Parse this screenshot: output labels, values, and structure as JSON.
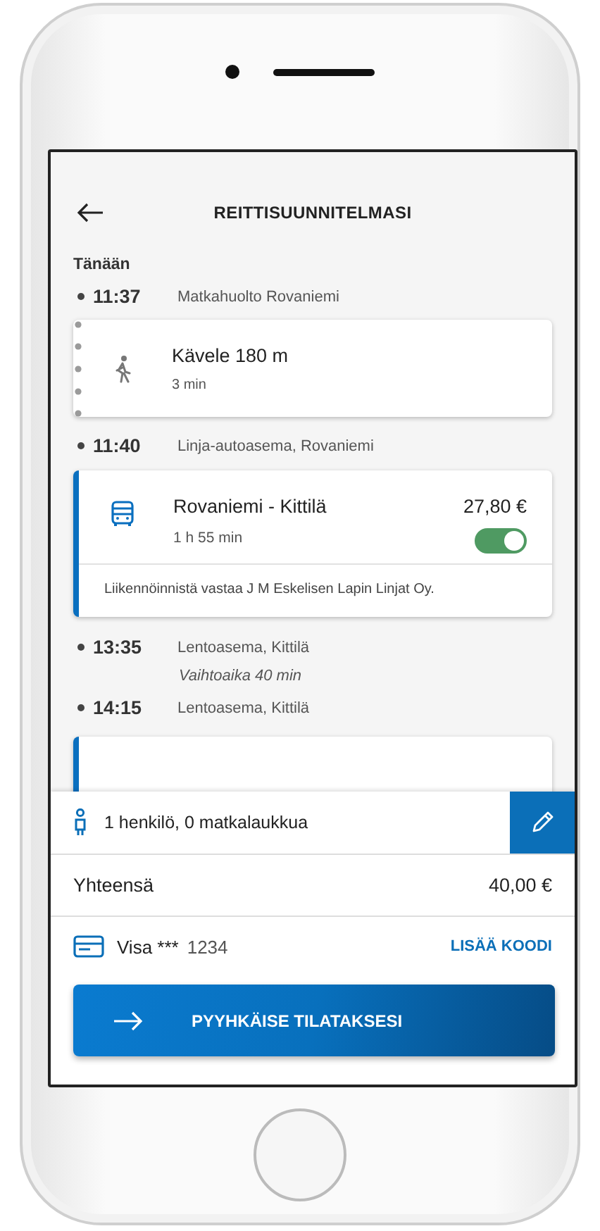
{
  "header": {
    "title": "REITTISUUNNITELMASI"
  },
  "day_label": "Tänään",
  "timeline": [
    {
      "kind": "stop",
      "time": "11:37",
      "place": "Matkahuolto Rovaniemi"
    },
    {
      "kind": "walk",
      "title": "Kävele 180 m",
      "duration": "3 min"
    },
    {
      "kind": "stop",
      "time": "11:40",
      "place": "Linja-autoasema, Rovaniemi"
    },
    {
      "kind": "ride",
      "route": "Rovaniemi - Kittilä",
      "duration": "1 h 55 min",
      "price": "27,80 €",
      "on": true,
      "operator": "Liikennöinnistä vastaa J M Eskelisen Lapin Linjat Oy."
    },
    {
      "kind": "stop",
      "time": "13:35",
      "place": "Lentoasema, Kittilä",
      "note": "Vaihtoaika 40 min"
    },
    {
      "kind": "stop",
      "time": "14:15",
      "place": "Lentoasema, Kittilä"
    },
    {
      "kind": "covered_ride"
    }
  ],
  "booking": {
    "passengers": "1 henkilö, 0 matkalaukkua",
    "total_label": "Yhteensä",
    "total": "40,00 €",
    "payment": "Visa ***",
    "card_number": "1234",
    "code_link": "LISÄÄ KOODI",
    "swipe_label": "PYYHKÄISE TILATAKSESI"
  }
}
